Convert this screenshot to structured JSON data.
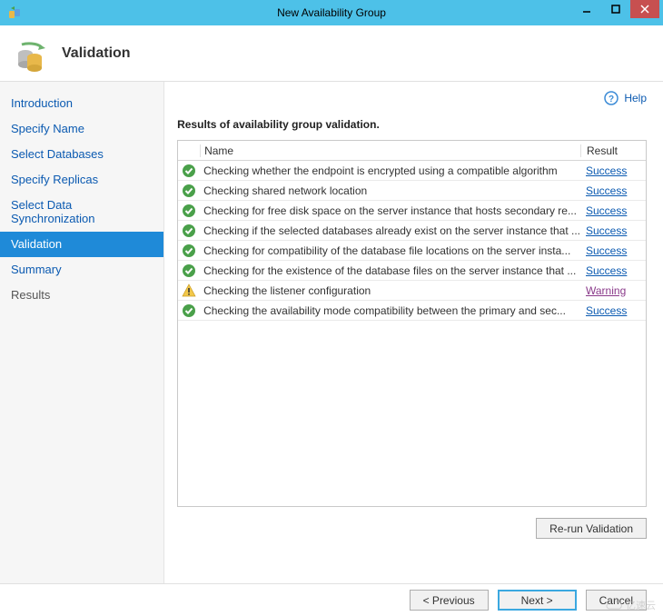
{
  "window": {
    "title": "New Availability Group"
  },
  "header": {
    "title": "Validation"
  },
  "help": {
    "label": "Help"
  },
  "sidebar": {
    "items": [
      {
        "label": "Introduction",
        "active": false
      },
      {
        "label": "Specify Name",
        "active": false
      },
      {
        "label": "Select Databases",
        "active": false
      },
      {
        "label": "Specify Replicas",
        "active": false
      },
      {
        "label": "Select Data Synchronization",
        "active": false
      },
      {
        "label": "Validation",
        "active": true
      },
      {
        "label": "Summary",
        "active": false
      },
      {
        "label": "Results",
        "active": false,
        "done": true
      }
    ]
  },
  "main": {
    "results_title": "Results of availability group validation.",
    "columns": {
      "name": "Name",
      "result": "Result"
    },
    "rows": [
      {
        "icon": "success",
        "name": "Checking whether the endpoint is encrypted using a compatible algorithm",
        "result": "Success"
      },
      {
        "icon": "success",
        "name": "Checking shared network location",
        "result": "Success"
      },
      {
        "icon": "success",
        "name": "Checking for free disk space on the server instance that hosts secondary re...",
        "result": "Success"
      },
      {
        "icon": "success",
        "name": "Checking if the selected databases already exist on the server instance that ...",
        "result": "Success"
      },
      {
        "icon": "success",
        "name": "Checking for compatibility of the database file locations on the server insta...",
        "result": "Success"
      },
      {
        "icon": "success",
        "name": "Checking for the existence of the database files on the server instance that ...",
        "result": "Success"
      },
      {
        "icon": "warning",
        "name": "Checking the listener configuration",
        "result": "Warning"
      },
      {
        "icon": "success",
        "name": "Checking the availability mode compatibility between the primary and sec...",
        "result": "Success"
      }
    ],
    "rerun_label": "Re-run Validation"
  },
  "footer": {
    "previous": "< Previous",
    "next": "Next >",
    "cancel": "Cancel"
  },
  "watermark": {
    "text": "亿速云"
  }
}
